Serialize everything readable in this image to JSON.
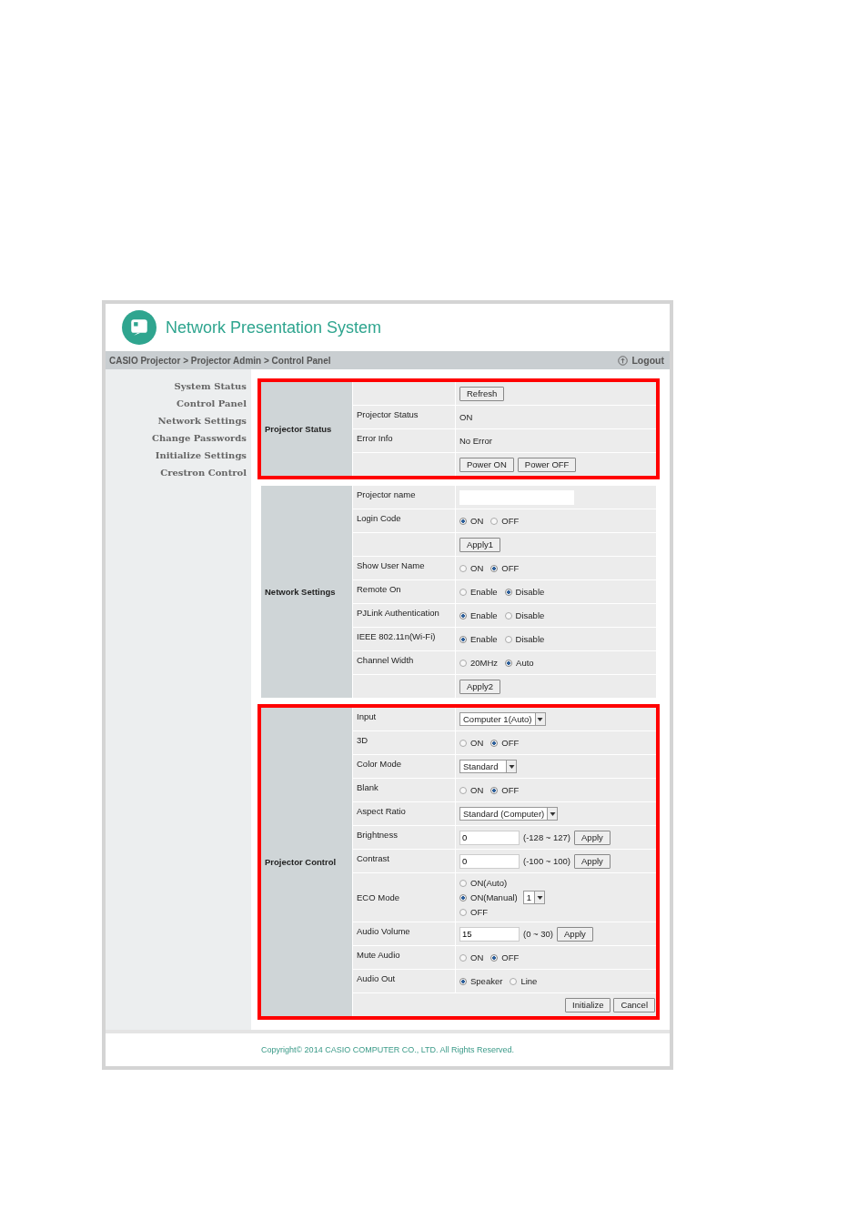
{
  "header": {
    "title": "Network Presentation System"
  },
  "breadcrumb": "CASIO Projector > Projector Admin > Control Panel",
  "logout": "Logout",
  "sidebar": [
    "System Status",
    "Control Panel",
    "Network Settings",
    "Change Passwords",
    "Initialize Settings",
    "Crestron Control"
  ],
  "sections": [
    {
      "title": "Projector Status",
      "highlighted": true,
      "rows": [
        {
          "kind": "buttons",
          "buttons": [
            "Refresh"
          ]
        },
        {
          "kind": "text",
          "label": "Projector Status",
          "value": "ON"
        },
        {
          "kind": "text",
          "label": "Error Info",
          "value": "No Error"
        },
        {
          "kind": "buttons",
          "buttons": [
            "Power ON",
            "Power OFF"
          ]
        }
      ]
    },
    {
      "title": "Network Settings",
      "highlighted": false,
      "rows": [
        {
          "kind": "input",
          "label": "Projector name"
        },
        {
          "kind": "radio",
          "label": "Login Code",
          "options": [
            {
              "label": "ON",
              "selected": true
            },
            {
              "label": "OFF",
              "selected": false
            }
          ]
        },
        {
          "kind": "buttons",
          "buttons": [
            "Apply1"
          ]
        },
        {
          "kind": "radio",
          "label": "Show User Name",
          "options": [
            {
              "label": "ON",
              "selected": false
            },
            {
              "label": "OFF",
              "selected": true
            }
          ]
        },
        {
          "kind": "radio",
          "label": "Remote On",
          "options": [
            {
              "label": "Enable",
              "selected": false
            },
            {
              "label": "Disable",
              "selected": true
            }
          ]
        },
        {
          "kind": "radio",
          "label": "PJLink Authentication",
          "options": [
            {
              "label": "Enable",
              "selected": true
            },
            {
              "label": "Disable",
              "selected": false
            }
          ]
        },
        {
          "kind": "radio",
          "label": "IEEE 802.11n(Wi-Fi)",
          "options": [
            {
              "label": "Enable",
              "selected": true
            },
            {
              "label": "Disable",
              "selected": false
            }
          ]
        },
        {
          "kind": "radio",
          "label": "Channel Width",
          "options": [
            {
              "label": "20MHz",
              "selected": false
            },
            {
              "label": "Auto",
              "selected": true
            }
          ]
        },
        {
          "kind": "buttons",
          "buttons": [
            "Apply2"
          ]
        }
      ]
    },
    {
      "title": "Projector Control",
      "highlighted": true,
      "rows": [
        {
          "kind": "select",
          "label": "Input",
          "value": "Computer 1(Auto)"
        },
        {
          "kind": "radio",
          "label": "3D",
          "options": [
            {
              "label": "ON",
              "selected": false
            },
            {
              "label": "OFF",
              "selected": true
            }
          ]
        },
        {
          "kind": "select",
          "label": "Color Mode",
          "value": "Standard"
        },
        {
          "kind": "radio",
          "label": "Blank",
          "options": [
            {
              "label": "ON",
              "selected": false
            },
            {
              "label": "OFF",
              "selected": true
            }
          ]
        },
        {
          "kind": "select",
          "label": "Aspect Ratio",
          "value": "Standard (Computer)"
        },
        {
          "kind": "number",
          "label": "Brightness",
          "value": "0",
          "range": "(-128 ~ 127)",
          "button": "Apply"
        },
        {
          "kind": "number",
          "label": "Contrast",
          "value": "0",
          "range": "(-100 ~ 100)",
          "button": "Apply"
        },
        {
          "kind": "radiolist",
          "label": "ECO Mode",
          "options": [
            {
              "label": "ON(Auto)",
              "selected": false
            },
            {
              "label": "ON(Manual)",
              "selected": true,
              "select": "1"
            },
            {
              "label": "OFF",
              "selected": false
            }
          ]
        },
        {
          "kind": "number",
          "label": "Audio Volume",
          "value": "15",
          "range": "(0 ~ 30)",
          "button": "Apply"
        },
        {
          "kind": "radio",
          "label": "Mute Audio",
          "options": [
            {
              "label": "ON",
              "selected": false
            },
            {
              "label": "OFF",
              "selected": true
            }
          ]
        },
        {
          "kind": "radio",
          "label": "Audio Out",
          "options": [
            {
              "label": "Speaker",
              "selected": true
            },
            {
              "label": "Line",
              "selected": false
            }
          ]
        },
        {
          "kind": "footer_buttons",
          "buttons": [
            "Initialize",
            "Cancel"
          ]
        }
      ]
    }
  ],
  "footer": "Copyright© 2014 CASIO COMPUTER CO., LTD. All Rights Reserved."
}
